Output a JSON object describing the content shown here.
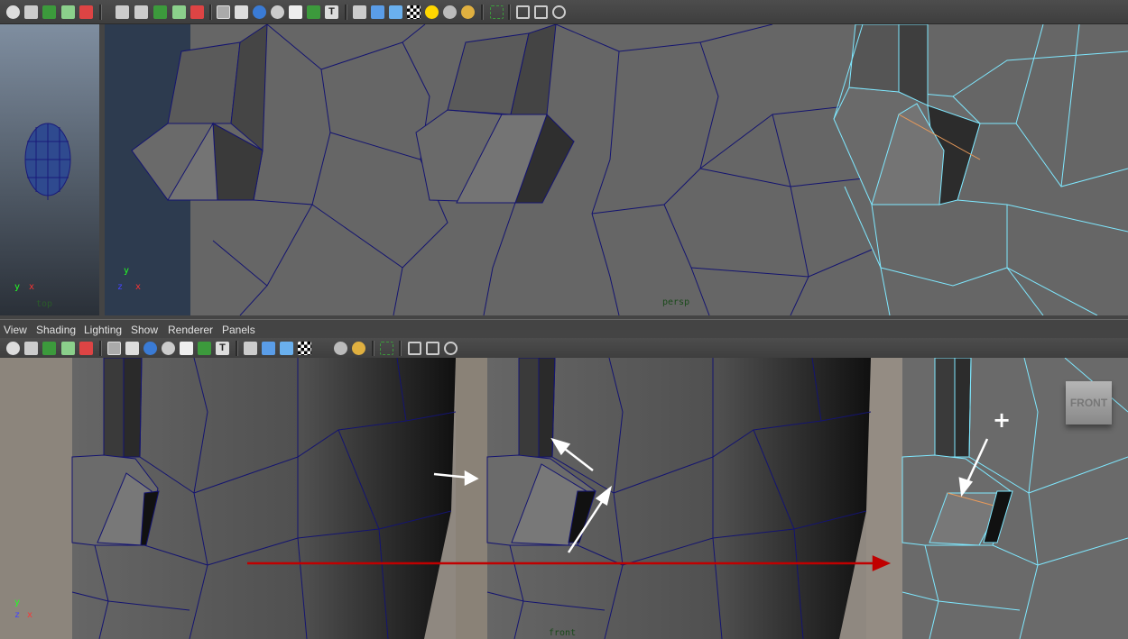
{
  "menubar": {
    "items": [
      {
        "label": "View"
      },
      {
        "label": "Shading"
      },
      {
        "label": "Lighting"
      },
      {
        "label": "Show"
      },
      {
        "label": "Renderer"
      },
      {
        "label": "Panels"
      }
    ]
  },
  "viewports": {
    "top": {
      "camera_label": "top",
      "axis_y": "y",
      "axis_x": "x"
    },
    "persp": {
      "camera_label": "persp",
      "axis_y": "y",
      "axis_z": "z",
      "axis_x": "x"
    },
    "front": {
      "camera_label": "front",
      "axis_y": "y",
      "axis_z": "z",
      "axis_x": "x",
      "view_cube_label": "FRONT",
      "cursor_glyph": "+"
    }
  },
  "colors": {
    "wire_selected": "#7fe8ff",
    "wire_default": "#1a1a7a",
    "edge_selected": "#e89a5a",
    "annotation_arrow": "#ffffff",
    "timeline_arrow": "#c00000"
  }
}
